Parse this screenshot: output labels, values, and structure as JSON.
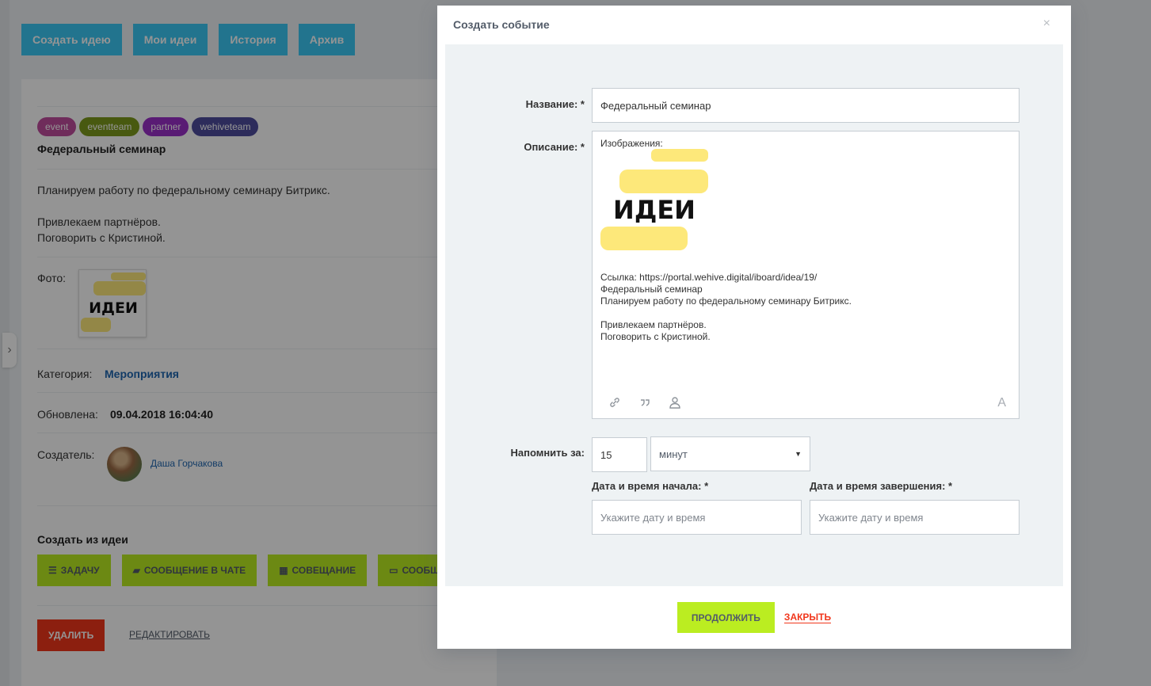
{
  "nav": {
    "buttons": [
      "Создать идею",
      "Мои идеи",
      "История",
      "Архив"
    ]
  },
  "idea": {
    "tags": [
      {
        "label": "event",
        "color": "#c04d9d"
      },
      {
        "label": "eventteam",
        "color": "#7d9a1c"
      },
      {
        "label": "partner",
        "color": "#9a2fc8"
      },
      {
        "label": "wehiveteam",
        "color": "#4e4d9e"
      }
    ],
    "title": "Федеральный семинар",
    "description": "Планируем работу по федеральному семинару Битрикс.\n\nПривлекаем партнёров.\nПоговорить с Кристиной.",
    "photo_label": "Фото:",
    "category_label": "Категория:",
    "category_value": "Мероприятия",
    "updated_label": "Обновлена:",
    "updated_value": "09.04.2018 16:04:40",
    "creator_label": "Создатель:",
    "creator_name": "Даша Горчакова",
    "create_from_title": "Создать из идеи",
    "actions": [
      "ЗАДАЧУ",
      "СООБЩЕНИЕ В ЧАТЕ",
      "СОВЕЩАНИЕ",
      "СООБЩ"
    ],
    "delete_label": "УДАЛИТЬ",
    "edit_label": "РЕДАКТИРОВАТЬ"
  },
  "logo": {
    "text": "ИДЕИ",
    "accent_color": "#fde87a"
  },
  "modal": {
    "title": "Создать событие",
    "close_icon": "×",
    "name_label": "Название: *",
    "name_value": "Федеральный семинар",
    "description_label": "Описание: *",
    "description_images_label": "Изображения:",
    "description_body": "Ссылка: https://portal.wehive.digital/iboard/idea/19/\nФедеральный семинар\nПланируем работу по федеральному семинару Битрикс.\n\nПривлекаем партнёров.\nПоговорить с Кристиной.",
    "editor_font_icon": "A",
    "remind_label": "Напомнить за:",
    "remind_value": "15",
    "remind_unit": "минут",
    "start_label": "Дата и время начала: *",
    "start_placeholder": "Укажите дату и время",
    "end_label": "Дата и время завершения: *",
    "end_placeholder": "Укажите дату и время",
    "continue_label": "ПРОДОЛЖИТЬ",
    "close_label": "ЗАКРЫТЬ"
  }
}
